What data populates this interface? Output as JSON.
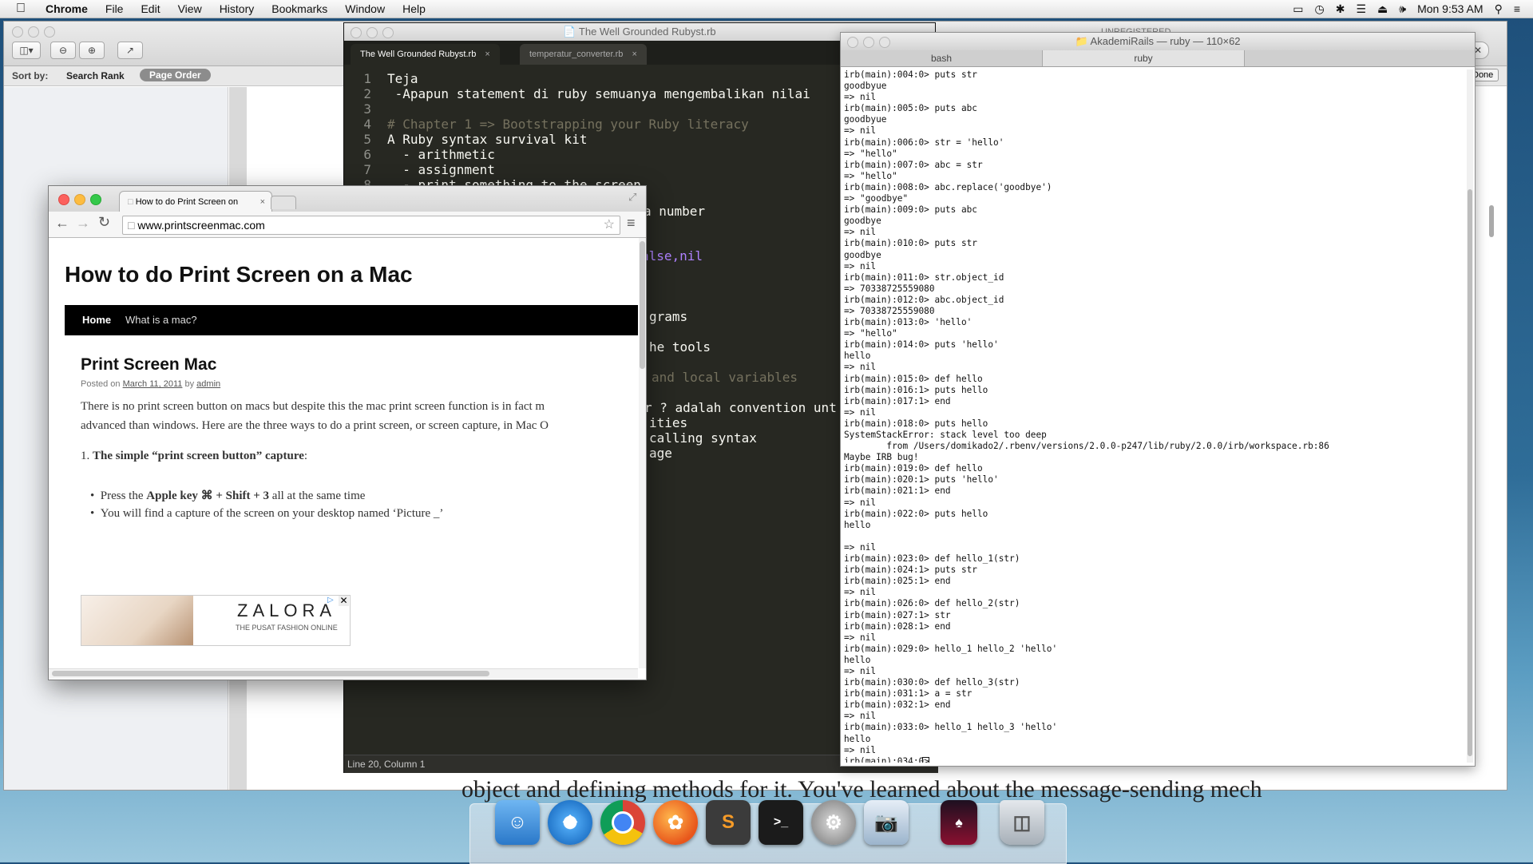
{
  "menubar": {
    "app_name": "Chrome",
    "items": [
      "File",
      "Edit",
      "View",
      "History",
      "Bookmarks",
      "Window",
      "Help"
    ],
    "clock": "Mon 9:53 AM"
  },
  "preview": {
    "sort_by_label": "Sort by:",
    "sort_search_rank": "Search Rank",
    "sort_page_order": "Page Order",
    "done_label": "Done",
    "book_text": "object and defining methods for it. You've learned about the message-sending mech"
  },
  "sublime": {
    "title": "The Well Grounded Rubyst.rb",
    "unregistered": "UNREGISTERED",
    "tabs": [
      "The Well Grounded Rubyst.rb",
      "temperatur_converter.rb"
    ],
    "status": "Line 20, Column 1",
    "lines": [
      {
        "n": "1",
        "text": "Teja",
        "cls": ""
      },
      {
        "n": "2",
        "text": " -Apapun statement di ruby semuanya mengembalikan nilai",
        "cls": ""
      },
      {
        "n": "3",
        "text": "",
        "cls": ""
      },
      {
        "n": "4",
        "text": "# Chapter 1 => Bootstrapping your Ruby literacy",
        "cls": "cm"
      },
      {
        "n": "5",
        "text": "A Ruby syntax survival kit",
        "cls": ""
      },
      {
        "n": "6",
        "text": "  - arithmetic",
        "cls": ""
      },
      {
        "n": "7",
        "text": "  - assignment",
        "cls": ""
      },
      {
        "n": "8",
        "text": "  - print something to the screen",
        "cls": ""
      }
    ],
    "visible_fragments": [
      {
        "text": "a number",
        "cls": ""
      },
      {
        "text": "alse,nil",
        "cls": "pu"
      },
      {
        "text": "grams",
        "cls": ""
      },
      {
        "text": "he tools",
        "cls": ""
      },
      {
        "text": "and local variables",
        "cls": "cm"
      },
      {
        "text": "r ? adalah convention unt",
        "cls": "mix"
      },
      {
        "text": "ities",
        "cls": ""
      },
      {
        "text": "calling syntax",
        "cls": ""
      },
      {
        "text": "age",
        "cls": ""
      }
    ]
  },
  "terminal": {
    "title": "AkademiRails — ruby — 110×62",
    "tabs": [
      "bash",
      "ruby"
    ],
    "lines": [
      "irb(main):004:0> puts str",
      "goodbyue",
      "=> nil",
      "irb(main):005:0> puts abc",
      "goodbyue",
      "=> nil",
      "irb(main):006:0> str = 'hello'",
      "=> \"hello\"",
      "irb(main):007:0> abc = str",
      "=> \"hello\"",
      "irb(main):008:0> abc.replace('goodbye')",
      "=> \"goodbye\"",
      "irb(main):009:0> puts abc",
      "goodbye",
      "=> nil",
      "irb(main):010:0> puts str",
      "goodbye",
      "=> nil",
      "irb(main):011:0> str.object_id",
      "=> 70338725559080",
      "irb(main):012:0> abc.object_id",
      "=> 70338725559080",
      "irb(main):013:0> 'hello'",
      "=> \"hello\"",
      "irb(main):014:0> puts 'hello'",
      "hello",
      "=> nil",
      "irb(main):015:0> def hello",
      "irb(main):016:1> puts hello",
      "irb(main):017:1> end",
      "=> nil",
      "irb(main):018:0> puts hello",
      "SystemStackError: stack level too deep",
      "        from /Users/domikado2/.rbenv/versions/2.0.0-p247/lib/ruby/2.0.0/irb/workspace.rb:86",
      "Maybe IRB bug!",
      "irb(main):019:0> def hello",
      "irb(main):020:1> puts 'hello'",
      "irb(main):021:1> end",
      "=> nil",
      "irb(main):022:0> puts hello",
      "hello",
      "",
      "=> nil",
      "irb(main):023:0> def hello_1(str)",
      "irb(main):024:1> puts str",
      "irb(main):025:1> end",
      "=> nil",
      "irb(main):026:0> def hello_2(str)",
      "irb(main):027:1> str",
      "irb(main):028:1> end",
      "=> nil",
      "irb(main):029:0> hello_1 hello_2 'hello'",
      "hello",
      "=> nil",
      "irb(main):030:0> def hello_3(str)",
      "irb(main):031:1> a = str",
      "irb(main):032:1> end",
      "=> nil",
      "irb(main):033:0> hello_1 hello_3 'hello'",
      "hello",
      "=> nil",
      "irb(main):034:0> "
    ]
  },
  "chrome": {
    "tab_title": "How to do Print Screen on",
    "url": "www.printscreenmac.com",
    "page": {
      "site_title": "How to do Print Screen on a Mac",
      "nav": [
        "Home",
        "What is a mac?"
      ],
      "post_title": "Print Screen Mac",
      "posted_on": "Posted on",
      "date": "March 11, 2011",
      "by": "by",
      "author": "admin",
      "para1": "There is no print screen button on macs but despite this the mac print screen function is in fact m",
      "para2": "advanced than windows. Here are the three ways to do a print screen, or screen capture, in Mac O",
      "section_num": "1.",
      "section_title": "The simple “print screen button” capture",
      "section_colon": ":",
      "bullet1_pre": "Press the ",
      "bullet1_key": "Apple key ⌘ + Shift + 3",
      "bullet1_post": " all at the same time",
      "bullet2": "You will find a capture of the screen on your desktop named ‘Picture _’",
      "ad_brand": "ZALORA",
      "ad_tagline": "THE PUSAT FASHION ONLINE"
    }
  },
  "dock": {
    "apps": [
      "finder",
      "safari",
      "chrome",
      "firefox",
      "sublime",
      "terminal",
      "system-preferences",
      "preview",
      "book",
      "trash"
    ]
  }
}
